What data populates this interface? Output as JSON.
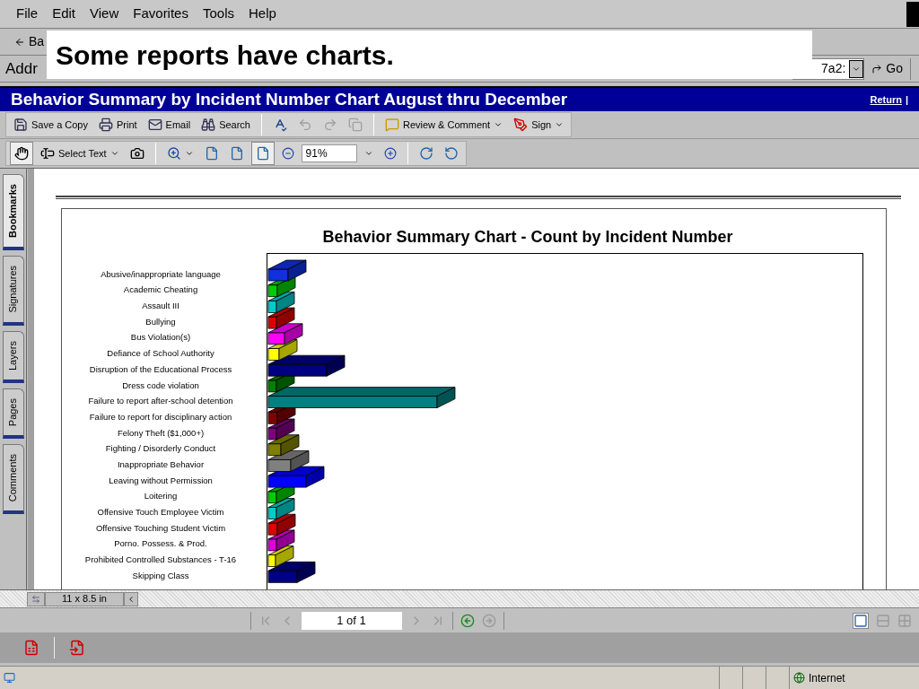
{
  "menu": [
    "File",
    "Edit",
    "View",
    "Favorites",
    "Tools",
    "Help"
  ],
  "ie_toolbar": {
    "back_label": "Ba"
  },
  "address_bar": {
    "label": "Addr",
    "value": "7a2:",
    "go": "Go"
  },
  "overlay": {
    "text": "Some reports have charts."
  },
  "header": {
    "title": "Behavior Summary by Incident Number Chart August thru December",
    "links": [
      "Return",
      "|"
    ]
  },
  "toolbar1": {
    "file_buttons": [
      "Save a Copy",
      "Print",
      "Email",
      "Search"
    ],
    "edit_buttons": [
      {
        "disabled": false
      },
      {
        "disabled": true
      },
      {
        "disabled": true
      },
      {
        "disabled": true
      }
    ],
    "review": "Review & Comment",
    "sign": "Sign"
  },
  "toolbar2": {
    "hand_tool": {
      "selected": true
    },
    "select_text": "Select Text",
    "view_buttons": [
      {
        "selected": false
      },
      {
        "selected": false
      },
      {
        "selected": true
      }
    ],
    "zoom_value": "91%"
  },
  "side_tabs": [
    {
      "label": "Bookmarks",
      "selected": true
    },
    {
      "label": "Signatures",
      "selected": false
    },
    {
      "label": "Layers",
      "selected": false
    },
    {
      "label": "Pages",
      "selected": false
    },
    {
      "label": "Comments",
      "selected": false
    }
  ],
  "chart": {
    "title": "Behavior Summary Chart - Count by Incident Number",
    "categories": [
      {
        "label": "Abusive/inappropriate language",
        "color": "#1030e0"
      },
      {
        "label": "Academic Cheating",
        "color": "#00cc00"
      },
      {
        "label": "Assault III",
        "color": "#00cccc"
      },
      {
        "label": "Bullying",
        "color": "#dd0000"
      },
      {
        "label": "Bus Violation(s)",
        "color": "#ff00ff"
      },
      {
        "label": "Defiance of School Authority",
        "color": "#ffff00"
      },
      {
        "label": "Disruption of the Educational Process",
        "color": "#000080"
      },
      {
        "label": "Dress code violation",
        "color": "#008000"
      },
      {
        "label": "Failure to report after-school detention",
        "color": "#008080"
      },
      {
        "label": "Failure to report for disciplinary action",
        "color": "#800000"
      },
      {
        "label": "Felony Theft ($1,000+)",
        "color": "#800080"
      },
      {
        "label": "Fighting / Disorderly Conduct",
        "color": "#808000"
      },
      {
        "label": "Inappropriate Behavior",
        "color": "#808080"
      },
      {
        "label": "Leaving without Permission",
        "color": "#0000ff"
      },
      {
        "label": "Loitering",
        "color": "#00cc00"
      },
      {
        "label": "Offensive Touch Employee Victim",
        "color": "#00cccc"
      },
      {
        "label": "Offensive Touching Student Victim",
        "color": "#dd0000"
      },
      {
        "label": "Porno. Possess. & Prod.",
        "color": "#dd00dd"
      },
      {
        "label": "Prohibited Controlled Substances - T-16",
        "color": "#ffff00"
      },
      {
        "label": "Skipping Class",
        "color": "#000080"
      }
    ]
  },
  "doc_status": {
    "page_size": "11 x 8.5 in"
  },
  "nav": {
    "buttons": [
      {
        "disabled": true
      },
      {
        "disabled": true
      },
      {
        "disabled": true
      },
      {
        "disabled": true
      }
    ],
    "page": "1 of 1",
    "history": [
      {
        "disabled": false
      },
      {
        "disabled": true
      }
    ],
    "view_modes": [
      {
        "selected": true
      },
      {
        "selected": false
      },
      {
        "selected": false
      }
    ]
  },
  "status_bar": {
    "zone": "Internet"
  }
}
